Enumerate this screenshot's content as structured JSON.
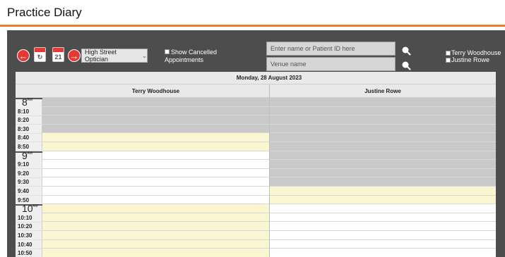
{
  "page": {
    "title": "Practice Diary"
  },
  "toolbar": {
    "prev_icon": "arrow-left-icon",
    "today_icon": "calendar-today-icon",
    "calendar_date": "21",
    "next_icon": "arrow-right-icon",
    "venue_select": {
      "selected": "High Street Optician"
    },
    "show_cancelled_label": "Show Cancelled",
    "show_cancelled_label2": "Appointments",
    "patient_search_placeholder": "Enter name or Patient ID here",
    "venue_search_placeholder": "Venue name",
    "staff_filters": [
      "Terry Woodhouse",
      "Justine Rowe"
    ]
  },
  "diary": {
    "date": "Monday, 28 August 2023",
    "practitioners": [
      "Terry Woodhouse",
      "Justine Rowe"
    ],
    "am_suffix": "AM",
    "hours": [
      {
        "hour": "8",
        "minute": ":00",
        "slots": [
          "8:10",
          "8:20",
          "8:30",
          "8:40",
          "8:50"
        ]
      },
      {
        "hour": "9",
        "minute": ":00",
        "slots": [
          "9:10",
          "9:20",
          "9:30",
          "9:40",
          "9:50"
        ]
      },
      {
        "hour": "10",
        "minute": ":00",
        "slots": [
          "10:10",
          "10:20",
          "10:30",
          "10:40",
          "10:50"
        ]
      }
    ],
    "cell_status": {
      "Terry Woodhouse": [
        "closed",
        "closed",
        "closed",
        "available",
        "available",
        "available",
        "open",
        "open",
        "open",
        "open",
        "open",
        "open",
        "available",
        "available",
        "available",
        "available",
        "available",
        "available"
      ],
      "Justine Rowe": [
        "closed",
        "closed",
        "closed",
        "closed",
        "closed",
        "closed",
        "closed",
        "closed",
        "closed",
        "available",
        "available",
        "available",
        "open",
        "open",
        "open",
        "open",
        "open",
        "open"
      ]
    },
    "colors": {
      "closed": "#c9c9c9",
      "available": "#faf6d2",
      "open": "#ffffff"
    }
  },
  "colors": {
    "accent": "#ee7a2f",
    "panel": "#4d4d4d",
    "nav": "#e53935"
  }
}
